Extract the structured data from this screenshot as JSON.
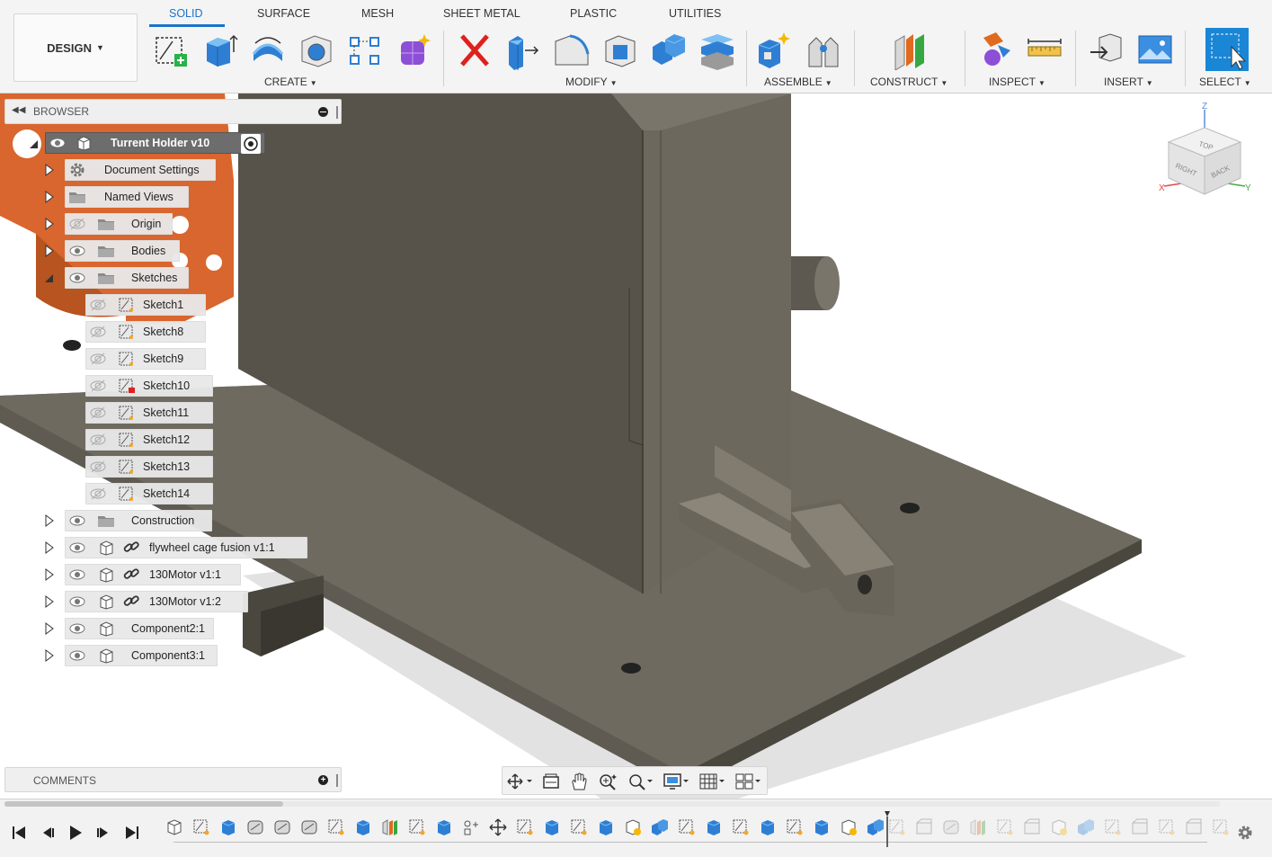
{
  "workspace": {
    "label": "DESIGN"
  },
  "tabs": [
    {
      "label": "SOLID",
      "active": true
    },
    {
      "label": "SURFACE"
    },
    {
      "label": "MESH"
    },
    {
      "label": "SHEET METAL"
    },
    {
      "label": "PLASTIC"
    },
    {
      "label": "UTILITIES"
    }
  ],
  "toolbar_groups": {
    "create": "CREATE",
    "modify": "MODIFY",
    "assemble": "ASSEMBLE",
    "construct": "CONSTRUCT",
    "inspect": "INSPECT",
    "insert": "INSERT",
    "select": "SELECT"
  },
  "tool_icons": [
    "create-sketch-icon",
    "extrude-icon",
    "revolve-icon",
    "hole-icon",
    "rectangular-pattern-icon",
    "create-form-icon",
    "delete-icon",
    "press-pull-icon",
    "fillet-icon",
    "shell-icon",
    "combine-icon",
    "offset-face-icon",
    "new-component-icon",
    "joint-icon",
    "offset-plane-icon",
    "interference-icon",
    "measure-icon",
    "insert-derive-icon",
    "insert-canvas-icon",
    "select-icon"
  ],
  "browser": {
    "title": "BROWSER",
    "root": {
      "label": "Turrent Holder v10"
    },
    "items": [
      {
        "label": "Document Settings",
        "icon": "gear-icon",
        "level": 1
      },
      {
        "label": "Named Views",
        "icon": "folder-icon",
        "level": 1
      },
      {
        "label": "Origin",
        "icon": "folder-icon",
        "level": 1,
        "visible": false
      },
      {
        "label": "Bodies",
        "icon": "folder-icon",
        "level": 1,
        "visible": true
      },
      {
        "label": "Sketches",
        "icon": "folder-icon",
        "level": 1,
        "visible": true,
        "expanded": true
      },
      {
        "label": "Sketch1",
        "icon": "sketch-icon",
        "level": 2,
        "visible": false
      },
      {
        "label": "Sketch8",
        "icon": "sketch-icon",
        "level": 2,
        "visible": false
      },
      {
        "label": "Sketch9",
        "icon": "sketch-icon",
        "level": 2,
        "visible": false
      },
      {
        "label": "Sketch10",
        "icon": "sketch-locked-icon",
        "level": 2,
        "visible": false
      },
      {
        "label": "Sketch11",
        "icon": "sketch-icon",
        "level": 2,
        "visible": false
      },
      {
        "label": "Sketch12",
        "icon": "sketch-icon",
        "level": 2,
        "visible": false
      },
      {
        "label": "Sketch13",
        "icon": "sketch-icon",
        "level": 2,
        "visible": false
      },
      {
        "label": "Sketch14",
        "icon": "sketch-icon",
        "level": 2,
        "visible": false
      },
      {
        "label": "Construction",
        "icon": "folder-icon",
        "level": 1,
        "visible": true
      },
      {
        "label": "flywheel cage fusion v1:1",
        "icon": "linked-component-icon",
        "level": 1,
        "visible": true
      },
      {
        "label": "130Motor v1:1",
        "icon": "linked-component-icon",
        "level": 1,
        "visible": true
      },
      {
        "label": "130Motor v1:2",
        "icon": "linked-component-icon",
        "level": 1,
        "visible": true
      },
      {
        "label": "Component2:1",
        "icon": "component-icon",
        "level": 1,
        "visible": true
      },
      {
        "label": "Component3:1",
        "icon": "component-icon",
        "level": 1,
        "visible": true
      }
    ]
  },
  "viewcube": {
    "top": "TOP",
    "right": "RIGHT",
    "back": "BACK",
    "axis_x": "X",
    "axis_y": "Y",
    "axis_z": "Z"
  },
  "comments": {
    "title": "COMMENTS"
  },
  "navbar_icons": [
    "orbit-icon",
    "look-at-icon",
    "pan-icon",
    "zoom-icon",
    "fit-icon",
    "display-settings-icon",
    "grid-icon",
    "viewports-icon"
  ],
  "timeline": {
    "controls": [
      "go-to-start-icon",
      "step-back-icon",
      "play-icon",
      "step-forward-icon",
      "go-to-end-icon"
    ],
    "completed_features": 27,
    "future_features": 13
  },
  "colors": {
    "accent": "#1a73c8",
    "model": "#5e5a50",
    "orange_part": "#d9662e"
  }
}
